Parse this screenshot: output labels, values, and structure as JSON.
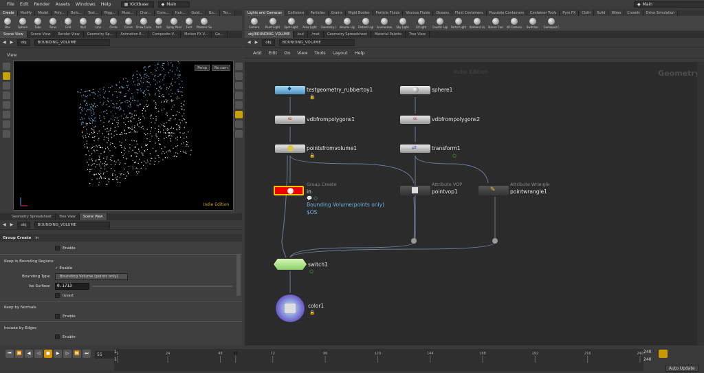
{
  "menubar": {
    "items": [
      "File",
      "Edit",
      "Render",
      "Assets",
      "Windows",
      "Help"
    ],
    "desktop": "Kickbase",
    "session": "Main",
    "session_right": "Main"
  },
  "left_shelf_tabs": [
    "Create",
    "Modify",
    "Model",
    "Poly...",
    "Defo...",
    "Text...",
    "Rigg...",
    "Musc...",
    "Char...",
    "Cons...",
    "Hair...",
    "Guid...",
    "Gu...",
    "Ter..."
  ],
  "left_shelf_tools": [
    "Box",
    "Sphere",
    "Tube",
    "Torus",
    "Grid",
    "Null",
    "Line",
    "Circle",
    "Curve",
    "Draw Curve",
    "Path",
    "Spray Paint",
    "Font",
    "Platonic Solids"
  ],
  "right_shelf_tabs": [
    "Lights and Cameras",
    "Collisions",
    "Particles",
    "Grains",
    "Rigid Bodies",
    "Particle Fluids",
    "Viscous Fluids",
    "Oceans",
    "Fluid Containers",
    "Populate Containers",
    "Container Tools",
    "Pyro FX",
    "Cloth",
    "Solid",
    "Wires",
    "Crowds",
    "Drive Simulation"
  ],
  "right_shelf_tools": [
    "Camera",
    "Point Light",
    "Spot Light",
    "Area Light",
    "Geometry Light",
    "Volume Light",
    "Distant Light",
    "Environment Light",
    "Sky Light",
    "GI Light",
    "Caustic Light",
    "Portal Light",
    "Ambient Light",
    "Stereo Camera",
    "VR Camera",
    "Switcher",
    "Gamepad Camera"
  ],
  "left_pane_tabs": [
    "Scene View",
    "Scene View",
    "Render View",
    "Geometry Sp...",
    "Animation E...",
    "Composite V...",
    "Motion FX V...",
    "Ge..."
  ],
  "right_pane_tabs": [
    "obj/BOUNDING_VOLUME",
    "/out",
    "/mat",
    "Geometry Spreadsheet",
    "Material Palette",
    "Tree View"
  ],
  "left_path": {
    "root": "obj",
    "node": "BOUNDING_VOLUME"
  },
  "right_path": {
    "root": "obj",
    "node": "BOUNDING_VOLUME"
  },
  "viewport": {
    "title": "View",
    "persp": "Persp",
    "cam": "No cam",
    "watermark": "Indie Edition"
  },
  "lower_tabs": [
    "Geometry Spreadsheet",
    "Tree View",
    "Scene View"
  ],
  "lower_path": {
    "root": "obj",
    "node": "BOUNDING_VOLUME"
  },
  "params": {
    "node_type": "Group Create",
    "node_name": "in",
    "enable1": "Enable",
    "section1": "Keep in Bounding Regions",
    "enable2": "Enable",
    "bounding_type_label": "Bounding Type",
    "bounding_type_value": "Bounding Volume (points only)",
    "iso_label": "Iso Surface",
    "iso_value": "0.1713",
    "invert": "Invert",
    "section2": "Keep by Normals",
    "enable3": "Enable",
    "section3": "Include by Edges",
    "enable4": "Enable"
  },
  "net_menu": [
    "Add",
    "Edit",
    "Go",
    "View",
    "Tools",
    "Layout",
    "Help"
  ],
  "net": {
    "watermark": "Indie Edition",
    "context": "Geometry",
    "nodes": {
      "n1": "testgeometry_rubbertoy1",
      "n2": "sphere1",
      "n3": "vdbfrompolygons1",
      "n4": "vdbfrompolygons2",
      "n5": "pointsfromvolume1",
      "n6": "transform1",
      "n7_type": "Group Create",
      "n7": "in",
      "n7_info1": "Bounding Volume(points only)",
      "n7_info2": "$OS",
      "n8_type": "Attribute VOP",
      "n8": "pointvop1",
      "n9_type": "Attribute Wrangle",
      "n9": "pointwrangle1",
      "n10": "switch1",
      "n11": "color1"
    }
  },
  "timeline": {
    "frame": "55",
    "start": "1",
    "start2": "1",
    "end": "240",
    "end2": "240",
    "ticks": [
      "1",
      "24",
      "48",
      "55",
      "72",
      "96",
      "120",
      "144",
      "168",
      "192",
      "216",
      "240"
    ],
    "auto_update": "Auto Update"
  }
}
